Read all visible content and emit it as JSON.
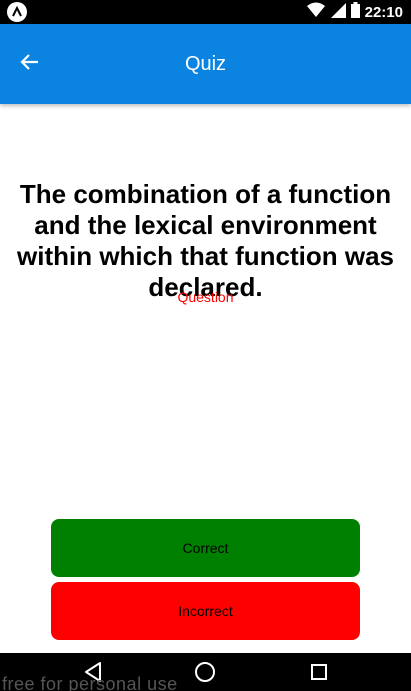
{
  "status_bar": {
    "time": "22:10"
  },
  "app_bar": {
    "title": "Quiz"
  },
  "question": {
    "text": "The combination of a function and the lexical environment within which that function was declared.",
    "label": "Question"
  },
  "answers": {
    "correct_label": "Correct",
    "incorrect_label": "Incorrect"
  },
  "watermark": "free for personal use",
  "colors": {
    "app_bar": "#0a84e0",
    "correct": "#008000",
    "incorrect": "#ff0000",
    "question_label": "#ff0000"
  }
}
